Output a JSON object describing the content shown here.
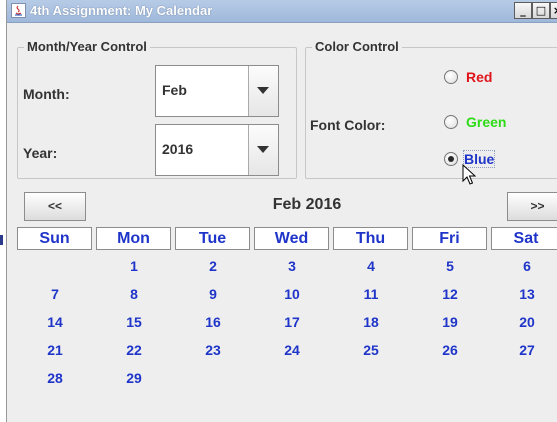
{
  "window": {
    "title": "4th Assignment: My Calendar",
    "controls": {
      "minimize": "_",
      "maximize": "□",
      "close": "×"
    }
  },
  "month_year_control": {
    "title": "Month/Year Control",
    "month_label": "Month:",
    "month_value": "Feb",
    "year_label": "Year:",
    "year_value": "2016"
  },
  "color_control": {
    "title": "Color Control",
    "font_color_label": "Font Color:",
    "options": [
      {
        "label": "Red",
        "color": "#e0141b",
        "selected": false
      },
      {
        "label": "Green",
        "color": "#2ddc16",
        "selected": false
      },
      {
        "label": "Blue",
        "color": "#1f35c9",
        "selected": true
      }
    ]
  },
  "navigation": {
    "prev_label": "<<",
    "next_label": ">>",
    "current": "Feb 2016"
  },
  "calendar": {
    "accent_color": "#1f35c9",
    "days": [
      "Sun",
      "Mon",
      "Tue",
      "Wed",
      "Thu",
      "Fri",
      "Sat"
    ],
    "weeks": [
      [
        "",
        "1",
        "2",
        "3",
        "4",
        "5",
        "6"
      ],
      [
        "7",
        "8",
        "9",
        "10",
        "11",
        "12",
        "13"
      ],
      [
        "14",
        "15",
        "16",
        "17",
        "18",
        "19",
        "20"
      ],
      [
        "21",
        "22",
        "23",
        "24",
        "25",
        "26",
        "27"
      ],
      [
        "28",
        "29",
        "",
        "",
        "",
        "",
        ""
      ]
    ]
  }
}
